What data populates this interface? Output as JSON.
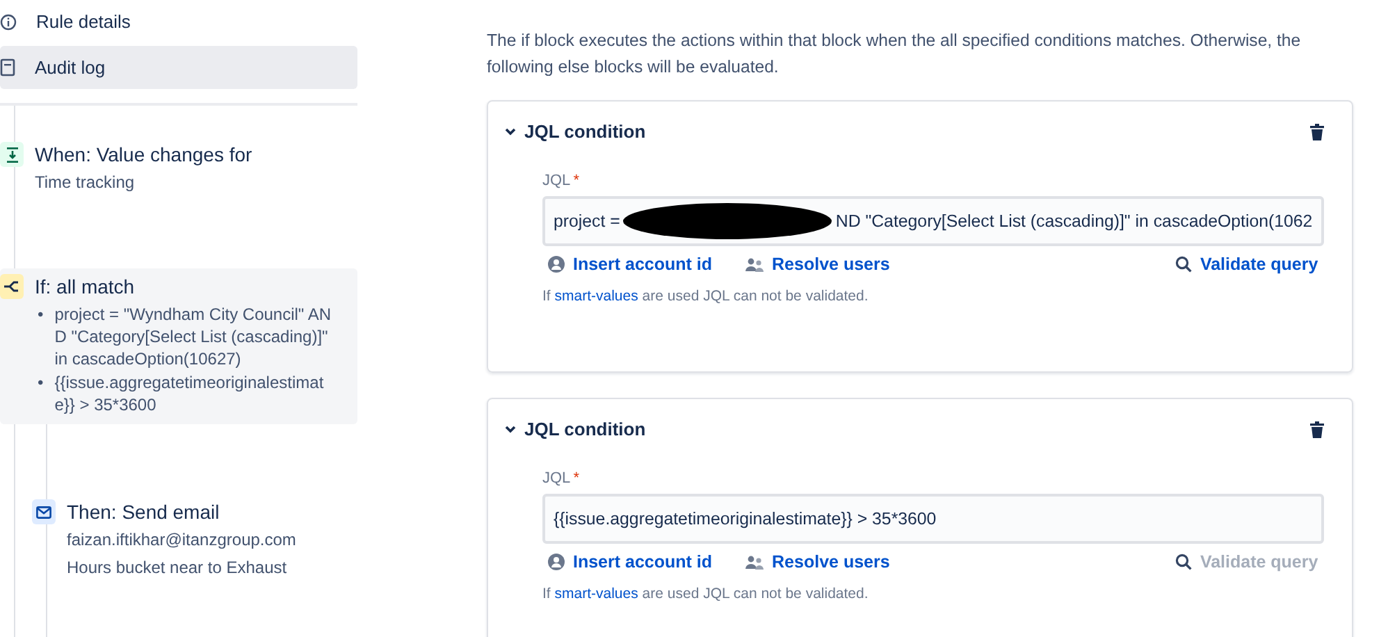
{
  "nav": [
    {
      "kind": "info",
      "label": "Rule details",
      "selected": false
    },
    {
      "kind": "log",
      "label": "Audit log",
      "selected": true
    }
  ],
  "steps": [
    {
      "kind": "trigger",
      "title": "When: Value changes for",
      "lines": [
        "Time tracking"
      ],
      "selected": false
    },
    {
      "kind": "condition",
      "title": "If: all match",
      "bullet_mark": "•",
      "bullets": [
        "project = \"Wyndham City Council\" AND \"Category[Select List (cascading)]\" in cascadeOption(10627)",
        "{{issue.aggregatetimeoriginalestimate}} > 35*3600"
      ],
      "selected": true,
      "children": [
        {
          "kind": "action",
          "title": "Then: Send email",
          "lines": [
            "faizan.iftikhar@itanzgroup.com",
            "Hours bucket near to Exhaust"
          ],
          "selected": false
        }
      ]
    }
  ],
  "description": "The if block executes the actions within that block when the all specified conditions matches. Otherwise, the following else blocks will be evaluated.",
  "conditions": [
    {
      "title": "JQL condition",
      "expanded": true,
      "label": "JQL",
      "required_mark": "*",
      "value_before": "project =",
      "redacted": true,
      "value_after": "ND \"Category[Select List (cascading)]\" in cascadeOption(1062",
      "actions": [
        {
          "kind": "account",
          "label": "Insert account id"
        },
        {
          "kind": "users",
          "label": "Resolve users"
        }
      ],
      "validate": {
        "label": "Validate query",
        "disabled": false
      },
      "hint_before": "If",
      "hint_link": "smart-values",
      "hint_after": "are used JQL can not be validated."
    },
    {
      "title": "JQL condition",
      "expanded": true,
      "label": "JQL",
      "required_mark": "*",
      "value_before": "{{issue.aggregatetimeoriginalestimate}} > 35*3600",
      "redacted": false,
      "actions": [
        {
          "kind": "account",
          "label": "Insert account id"
        },
        {
          "kind": "users",
          "label": "Resolve users"
        }
      ],
      "validate": {
        "label": "Validate query",
        "disabled": true
      },
      "hint_before": "If",
      "hint_link": "smart-values",
      "hint_after": "are used JQL can not be validated."
    }
  ]
}
